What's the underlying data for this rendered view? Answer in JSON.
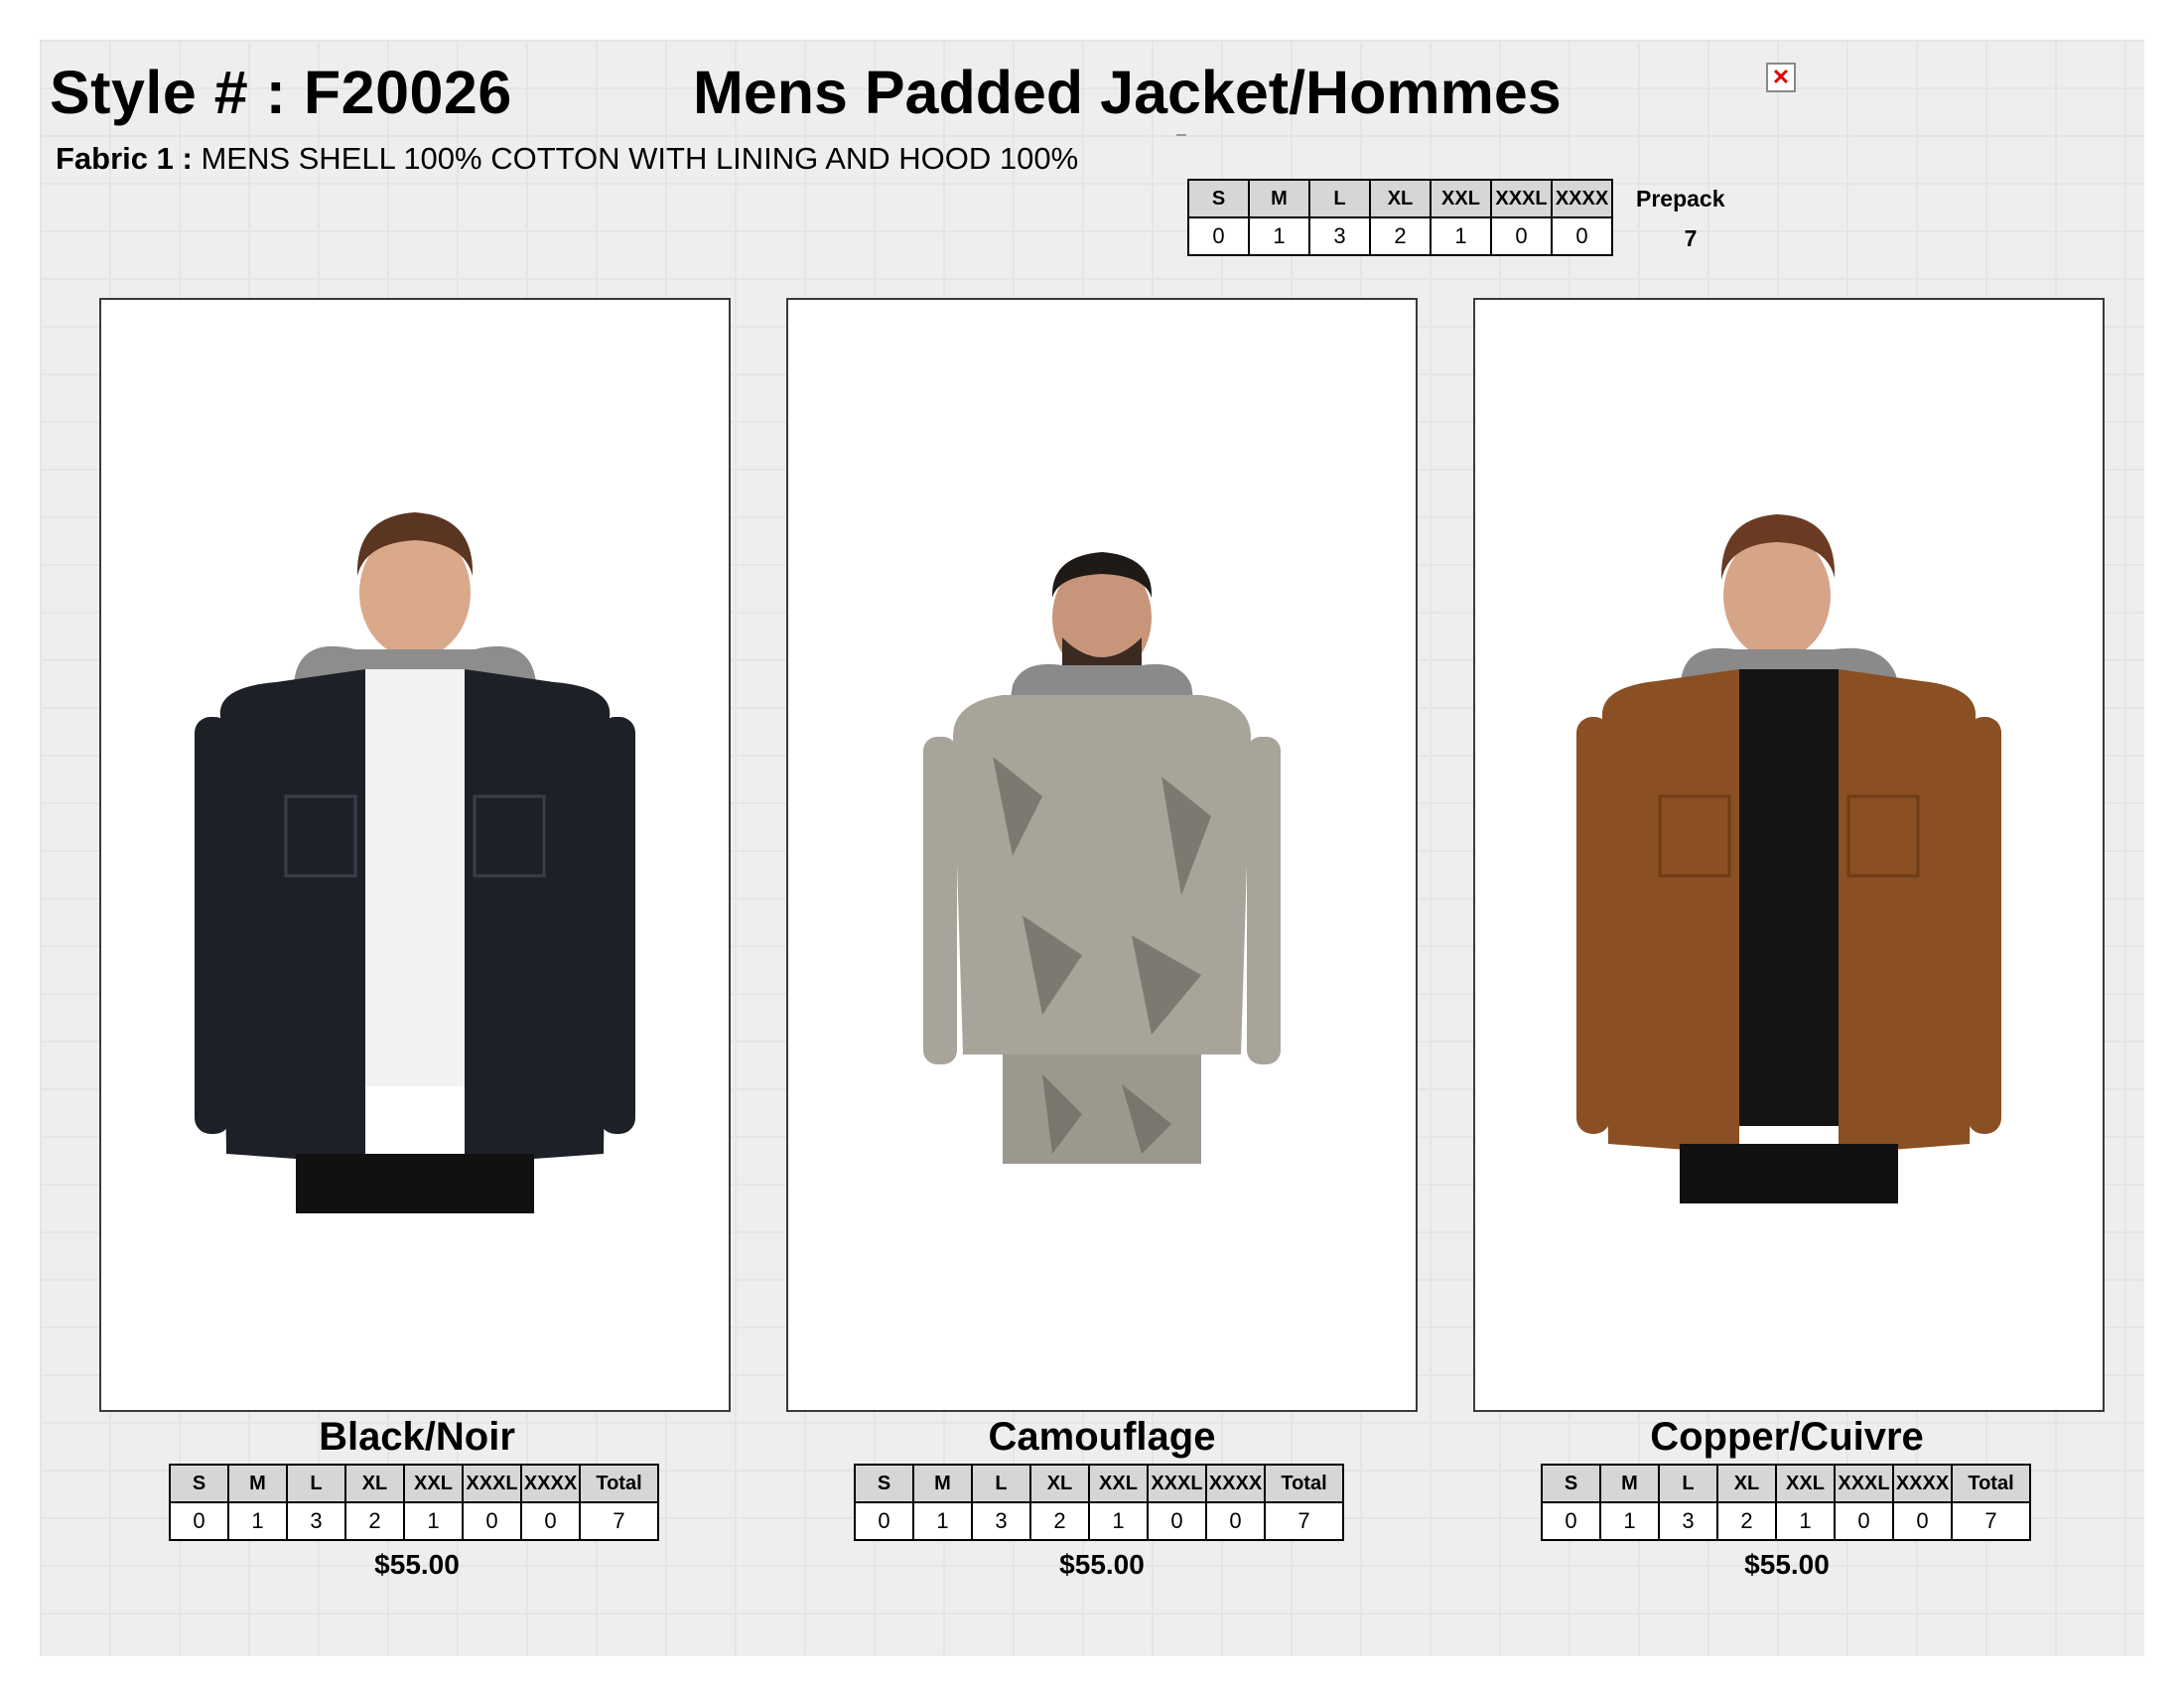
{
  "header": {
    "style_label": "Style # : F20026",
    "title": "Mens Padded Jacket/Hommes",
    "fabric_label": "Fabric 1 :",
    "fabric_text": "MENS SHELL 100% COTTON WITH LINING AND HOOD 100%"
  },
  "prepack": {
    "sizes": [
      "S",
      "M",
      "L",
      "XL",
      "XXL",
      "XXXL",
      "XXXX"
    ],
    "quantities": [
      "0",
      "1",
      "3",
      "2",
      "1",
      "0",
      "0"
    ],
    "label": "Prepack",
    "total": "7"
  },
  "icons": {
    "close": "close-icon"
  },
  "products": [
    {
      "color_name": "Black/Noir",
      "jacket_color": "#1d2027",
      "sizes": [
        "S",
        "M",
        "L",
        "XL",
        "XXL",
        "XXXL",
        "XXXX"
      ],
      "quantities": [
        "0",
        "1",
        "3",
        "2",
        "1",
        "0",
        "0"
      ],
      "total_label": "Total",
      "total": "7",
      "price": "$55.00"
    },
    {
      "color_name": "Camouflage",
      "jacket_color": "#a9a49a",
      "sizes": [
        "S",
        "M",
        "L",
        "XL",
        "XXL",
        "XXXL",
        "XXXX"
      ],
      "quantities": [
        "0",
        "1",
        "3",
        "2",
        "1",
        "0",
        "0"
      ],
      "total_label": "Total",
      "total": "7",
      "price": "$55.00"
    },
    {
      "color_name": "Copper/Cuivre",
      "jacket_color": "#8a4f22",
      "sizes": [
        "S",
        "M",
        "L",
        "XL",
        "XXL",
        "XXXL",
        "XXXX"
      ],
      "quantities": [
        "0",
        "1",
        "3",
        "2",
        "1",
        "0",
        "0"
      ],
      "total_label": "Total",
      "total": "7",
      "price": "$55.00"
    }
  ]
}
